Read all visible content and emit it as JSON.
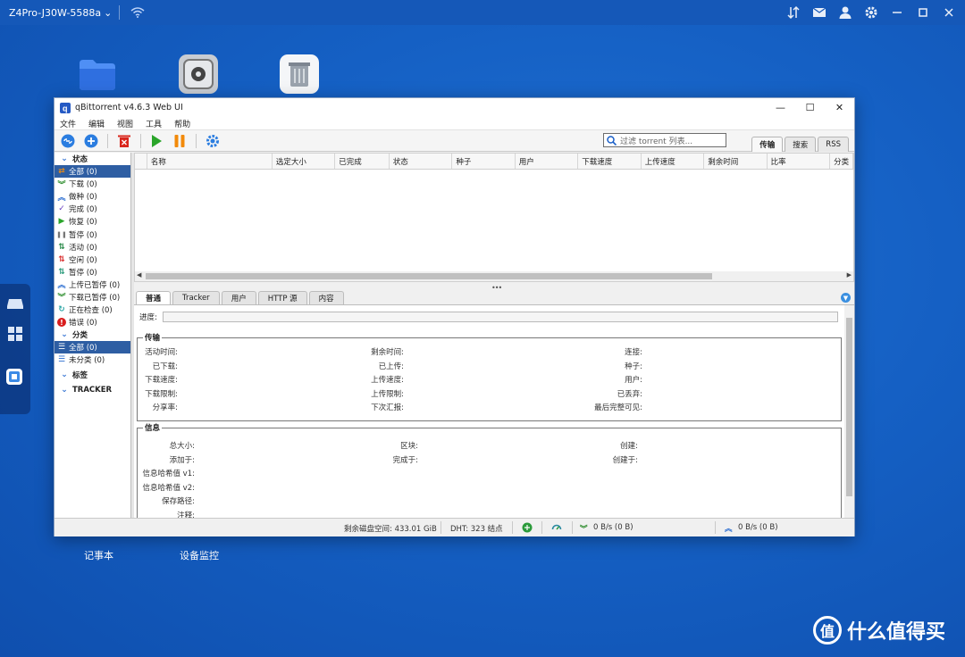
{
  "topbar": {
    "host": "Z4Pro-J30W-5588a",
    "chevron": "⌄",
    "icons": [
      "wifi-icon",
      "sort-icon",
      "mail-icon",
      "user-icon",
      "gear-icon",
      "minimize-icon",
      "maximize-icon",
      "close-icon"
    ]
  },
  "desktop": {
    "labels": {
      "notepad": "记事本",
      "monitor": "设备监控"
    }
  },
  "window": {
    "title": "qBittorrent v4.6.3 Web UI",
    "controls": {
      "min": "—",
      "max": "☐",
      "close": "✕"
    },
    "menu": [
      "文件",
      "编辑",
      "视图",
      "工具",
      "帮助"
    ],
    "search_placeholder": "过滤 torrent 列表...",
    "right_tabs": [
      "传输",
      "搜索",
      "RSS"
    ],
    "sidebar": {
      "status_header": "状态",
      "status_items": [
        {
          "label": "全部 (0)",
          "icon": "shuffle",
          "color": "#e68a1a"
        },
        {
          "label": "下载 (0)",
          "icon": "down",
          "color": "#2f8f2f"
        },
        {
          "label": "做种 (0)",
          "icon": "up",
          "color": "#2e6fd1"
        },
        {
          "label": "完成 (0)",
          "icon": "check",
          "color": "#6a3fbf"
        },
        {
          "label": "恢复 (0)",
          "icon": "play",
          "color": "#2aa52a"
        },
        {
          "label": "暂停 (0)",
          "icon": "pause",
          "color": "#777777"
        },
        {
          "label": "活动 (0)",
          "icon": "updown",
          "color": "#2a8a4a"
        },
        {
          "label": "空闲 (0)",
          "icon": "updown",
          "color": "#d93030"
        },
        {
          "label": "暂停 (0)",
          "icon": "updown",
          "color": "#2a9a7a"
        },
        {
          "label": "上传已暂停 (0)",
          "icon": "up",
          "color": "#2e6fd1"
        },
        {
          "label": "下载已暂停 (0)",
          "icon": "down",
          "color": "#2f8f2f"
        },
        {
          "label": "正在检查 (0)",
          "icon": "refresh",
          "color": "#2aa5a5"
        },
        {
          "label": "错误 (0)",
          "icon": "error",
          "color": "#d91e1e"
        }
      ],
      "category_header": "分类",
      "category_items": [
        "全部 (0)",
        "未分类 (0)"
      ],
      "tags_header": "标签",
      "tracker_header": "TRACKER"
    },
    "columns": [
      "名称",
      "选定大小",
      "已完成",
      "状态",
      "种子",
      "用户",
      "下载速度",
      "上传速度",
      "剩余时间",
      "比率",
      "分类"
    ],
    "detail_tabs": [
      "普通",
      "Tracker",
      "用户",
      "HTTP 源",
      "内容"
    ],
    "progress_label": "进度:",
    "transfer_title": "传输",
    "transfer": {
      "col1": [
        "活动时间:",
        "已下载:",
        "下载速度:",
        "下载限制:",
        "分享率:"
      ],
      "col2": [
        "剩余时间:",
        "已上传:",
        "上传速度:",
        "上传限制:",
        "下次汇报:"
      ],
      "col3": [
        "连接:",
        "种子:",
        "用户:",
        "已丢弃:",
        "最后完整可见:"
      ]
    },
    "info_title": "信息",
    "info": {
      "col1": [
        "总大小:",
        "添加于:",
        "信息哈希值 v1:",
        "信息哈希值 v2:",
        "保存路径:",
        "注释:"
      ],
      "col2": [
        "区块:",
        "完成于:"
      ],
      "col3": [
        "创建:",
        "创建于:"
      ]
    },
    "status": {
      "disk": "剩余磁盘空间: 433.01 GiB",
      "dht": "DHT: 323 结点",
      "down": "0 B/s (0 B)",
      "up": "0 B/s (0 B)"
    }
  },
  "watermark": {
    "text": "什么值得买",
    "logo": "值"
  }
}
